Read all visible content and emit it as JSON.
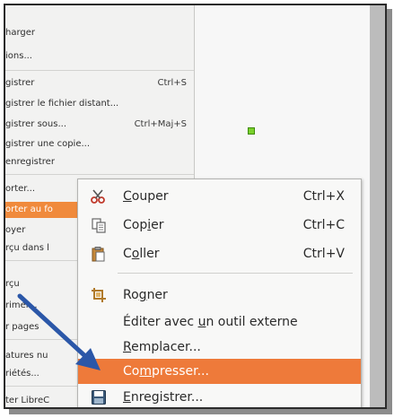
{
  "file_menu": {
    "items": [
      {
        "label": "harger",
        "shortcut": ""
      },
      {
        "label": "ions...",
        "shortcut": ""
      },
      {
        "label": "gistrer",
        "shortcut": "Ctrl+S"
      },
      {
        "label": "gistrer le fichier distant...",
        "shortcut": ""
      },
      {
        "label": "gistrer sous...",
        "shortcut": "Ctrl+Maj+S"
      },
      {
        "label": "gistrer une copie...",
        "shortcut": ""
      },
      {
        "label": " enregistrer",
        "shortcut": ""
      },
      {
        "label": "orter...",
        "shortcut": ""
      },
      {
        "label": "orter au fo",
        "shortcut": ""
      },
      {
        "label": "oyer",
        "shortcut": ""
      },
      {
        "label": "rçu dans l",
        "shortcut": ""
      },
      {
        "label": "rçu",
        "shortcut": ""
      },
      {
        "label": "rimer...",
        "shortcut": ""
      },
      {
        "label": "r pages",
        "shortcut": ""
      },
      {
        "label": "atures nu",
        "shortcut": ""
      },
      {
        "label": "riétés...",
        "shortcut": ""
      },
      {
        "label": "ter LibreC",
        "shortcut": ""
      }
    ]
  },
  "context_menu": {
    "cut": {
      "pre": "",
      "u": "C",
      "post": "ouper",
      "shortcut": "Ctrl+X",
      "icon": "scissors-icon"
    },
    "copy": {
      "pre": "Cop",
      "u": "i",
      "post": "er",
      "shortcut": "Ctrl+C",
      "icon": "copy-icon"
    },
    "paste": {
      "pre": "C",
      "u": "o",
      "post": "ller",
      "shortcut": "Ctrl+V",
      "icon": "clipboard-icon"
    },
    "crop": {
      "pre": "Ro",
      "u": "g",
      "post": "ner",
      "icon": "crop-icon"
    },
    "edit_external": {
      "pre": "Éditer avec ",
      "u": "u",
      "post": "n outil externe"
    },
    "replace": {
      "pre": "",
      "u": "R",
      "post": "emplacer..."
    },
    "compress": {
      "pre": "Co",
      "u": "m",
      "post": "presser..."
    },
    "save": {
      "pre": "",
      "u": "E",
      "post": "nregistrer...",
      "icon": "save-icon"
    }
  },
  "colors": {
    "highlight": "#ee7a3a",
    "arrow": "#2b57a8",
    "handle": "#7ad12c"
  }
}
